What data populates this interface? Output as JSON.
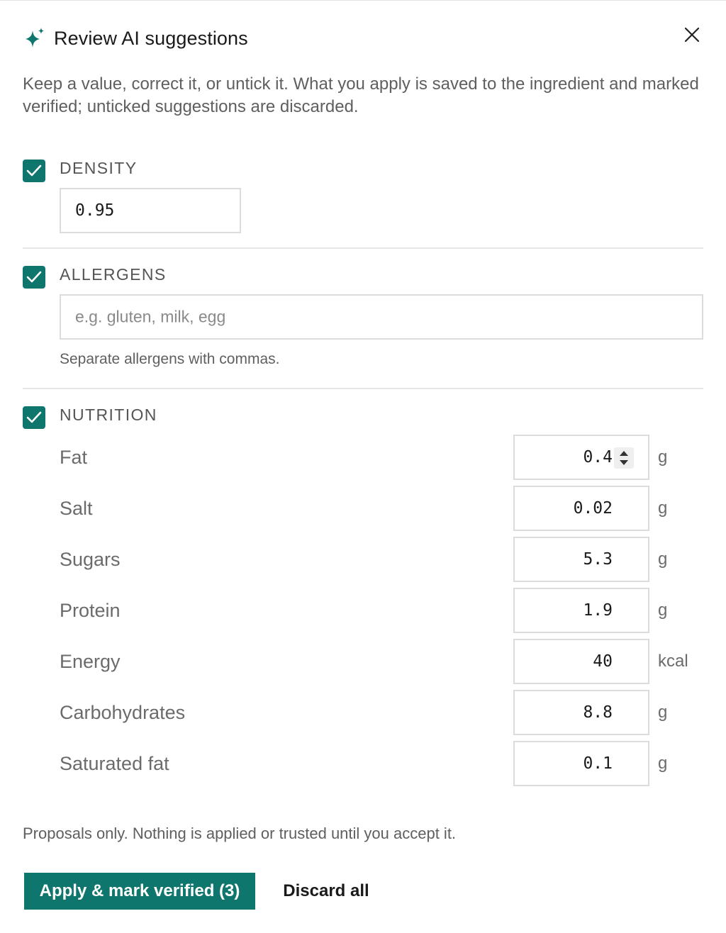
{
  "dialog": {
    "title": "Review AI suggestions",
    "intro": "Keep a value, correct it, or untick it. What you apply is saved to the ingredient and marked verified; unticked suggestions are discarded."
  },
  "density": {
    "label": "DENSITY",
    "checked": true,
    "value": "0.95"
  },
  "allergens": {
    "label": "ALLERGENS",
    "checked": true,
    "value": "",
    "placeholder": "e.g. gluten, milk, egg",
    "hint": "Separate allergens with commas."
  },
  "nutrition": {
    "label": "NUTRITION",
    "checked": true,
    "rows": [
      {
        "name": "Fat",
        "value": "0.4",
        "unit": "g"
      },
      {
        "name": "Salt",
        "value": "0.02",
        "unit": "g"
      },
      {
        "name": "Sugars",
        "value": "5.3",
        "unit": "g"
      },
      {
        "name": "Protein",
        "value": "1.9",
        "unit": "g"
      },
      {
        "name": "Energy",
        "value": "40",
        "unit": "kcal"
      },
      {
        "name": "Carbohydrates",
        "value": "8.8",
        "unit": "g"
      },
      {
        "name": "Saturated fat",
        "value": "0.1",
        "unit": "g"
      }
    ]
  },
  "footer": {
    "note": "Proposals only. Nothing is applied or trusted until you accept it.",
    "apply_label": "Apply & mark verified (3)",
    "discard_label": "Discard all"
  },
  "colors": {
    "accent": "#0f766e",
    "border": "#dcdcdc",
    "muted_text": "#5f5f5f"
  },
  "icons": {
    "title": "sparkle-icon",
    "close": "close-icon",
    "check": "checkmark-icon",
    "spinner": "stepper-arrows-icon"
  }
}
